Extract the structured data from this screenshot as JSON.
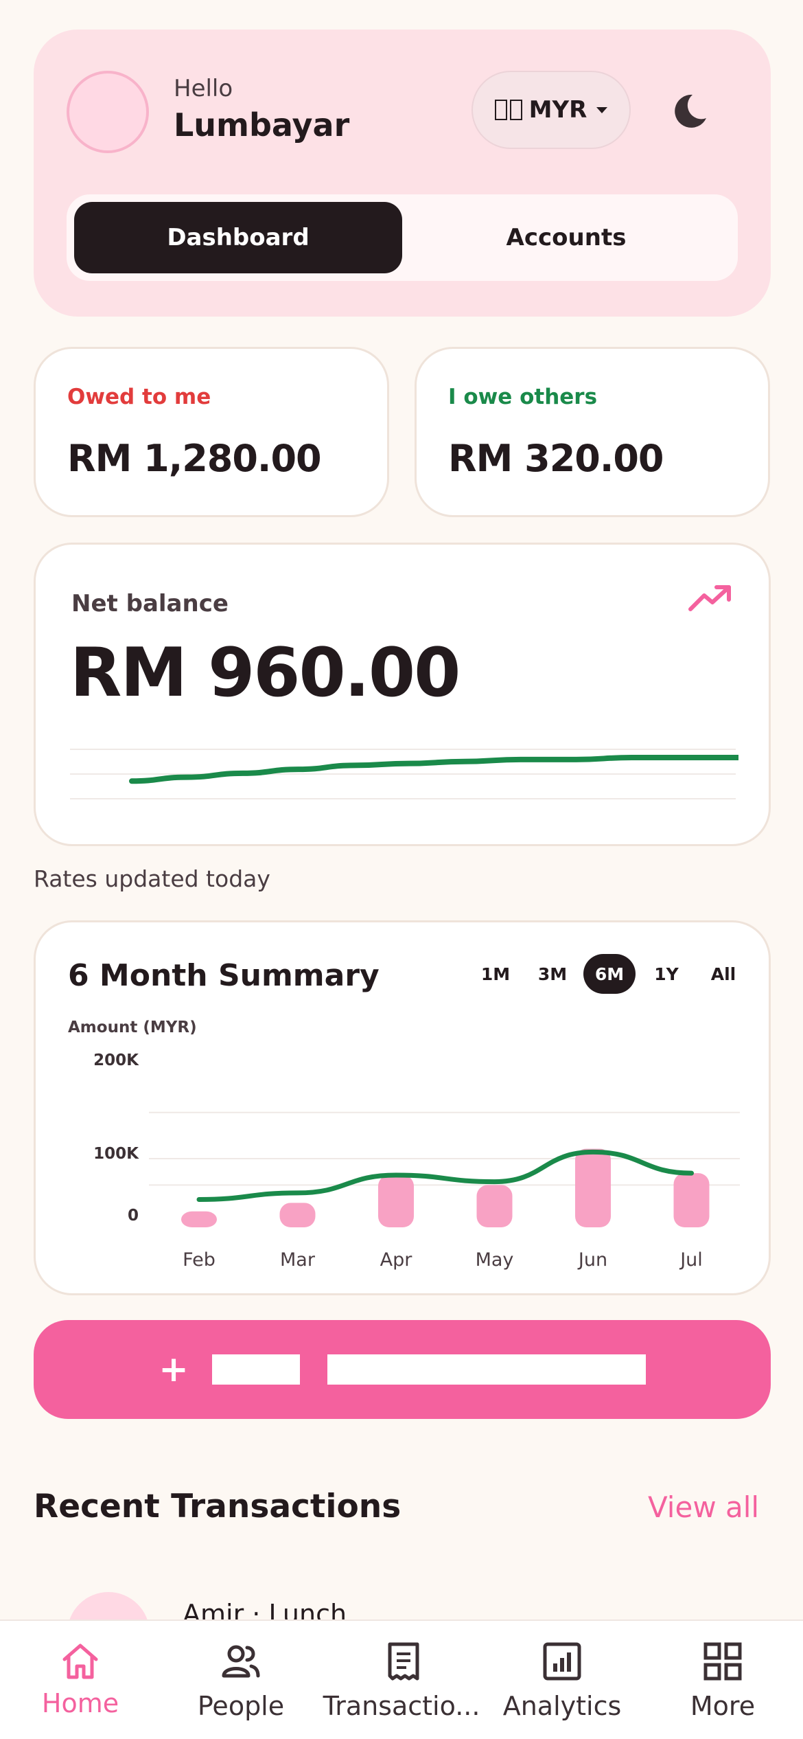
{
  "header": {
    "greeting": "Hello",
    "user_name": "Lumbayar",
    "currency": "MYR",
    "avatar_icon": "avatar",
    "theme_icon": "moon-icon",
    "tabs": [
      {
        "label": "Dashboard",
        "active": true
      },
      {
        "label": "Accounts",
        "active": false
      }
    ]
  },
  "balances": {
    "owed_label": "Owed to me",
    "owed_amount": "RM 1,280.00",
    "owe_label": "I owe others",
    "owe_amount": "RM 320.00"
  },
  "net": {
    "label": "Net balance",
    "amount": "RM 960.00"
  },
  "rates_note": "Rates updated today",
  "summary": {
    "title": "6 Month Summary",
    "ranges": [
      "1M",
      "3M",
      "6M",
      "1Y",
      "All"
    ],
    "active_range": "6M",
    "axis_title": "Amount (MYR)"
  },
  "chart_data": {
    "type": "bar",
    "title": "6 Month Summary",
    "ylabel": "Amount (MYR)",
    "categories": [
      "Feb",
      "Mar",
      "Apr",
      "May",
      "Jun",
      "Jul"
    ],
    "ytick_labels": [
      "200K",
      "100K",
      "0"
    ],
    "ylim": [
      0,
      200000
    ],
    "series": [
      {
        "values": [
          20000,
          33000,
          75000,
          60000,
          115000,
          78000
        ]
      },
      {
        "values": [
          38000,
          48000,
          75000,
          65000,
          110000,
          78000
        ]
      }
    ],
    "grid": true
  },
  "net_trend": {
    "values": [
      2,
      4,
      6,
      8,
      10,
      11,
      12,
      13,
      13,
      14,
      14,
      14
    ]
  },
  "cta": {
    "plus": "+"
  },
  "recent": {
    "title": "Recent Transactions",
    "view_all": "View all",
    "first_item": "Amir · Lunch"
  },
  "nav": {
    "items": [
      {
        "label": "Home",
        "icon": "home-icon",
        "active": true
      },
      {
        "label": "People",
        "icon": "people-icon",
        "active": false
      },
      {
        "label": "Transactio...",
        "icon": "receipt-icon",
        "active": false
      },
      {
        "label": "Analytics",
        "icon": "analytics-icon",
        "active": false
      },
      {
        "label": "More",
        "icon": "grid-icon",
        "active": false
      }
    ]
  },
  "colors": {
    "accent": "#f4619e",
    "positive": "#1a8a4a",
    "negative": "#e23c3c",
    "bar": "#f8a2c4",
    "dark": "#231a1d"
  }
}
